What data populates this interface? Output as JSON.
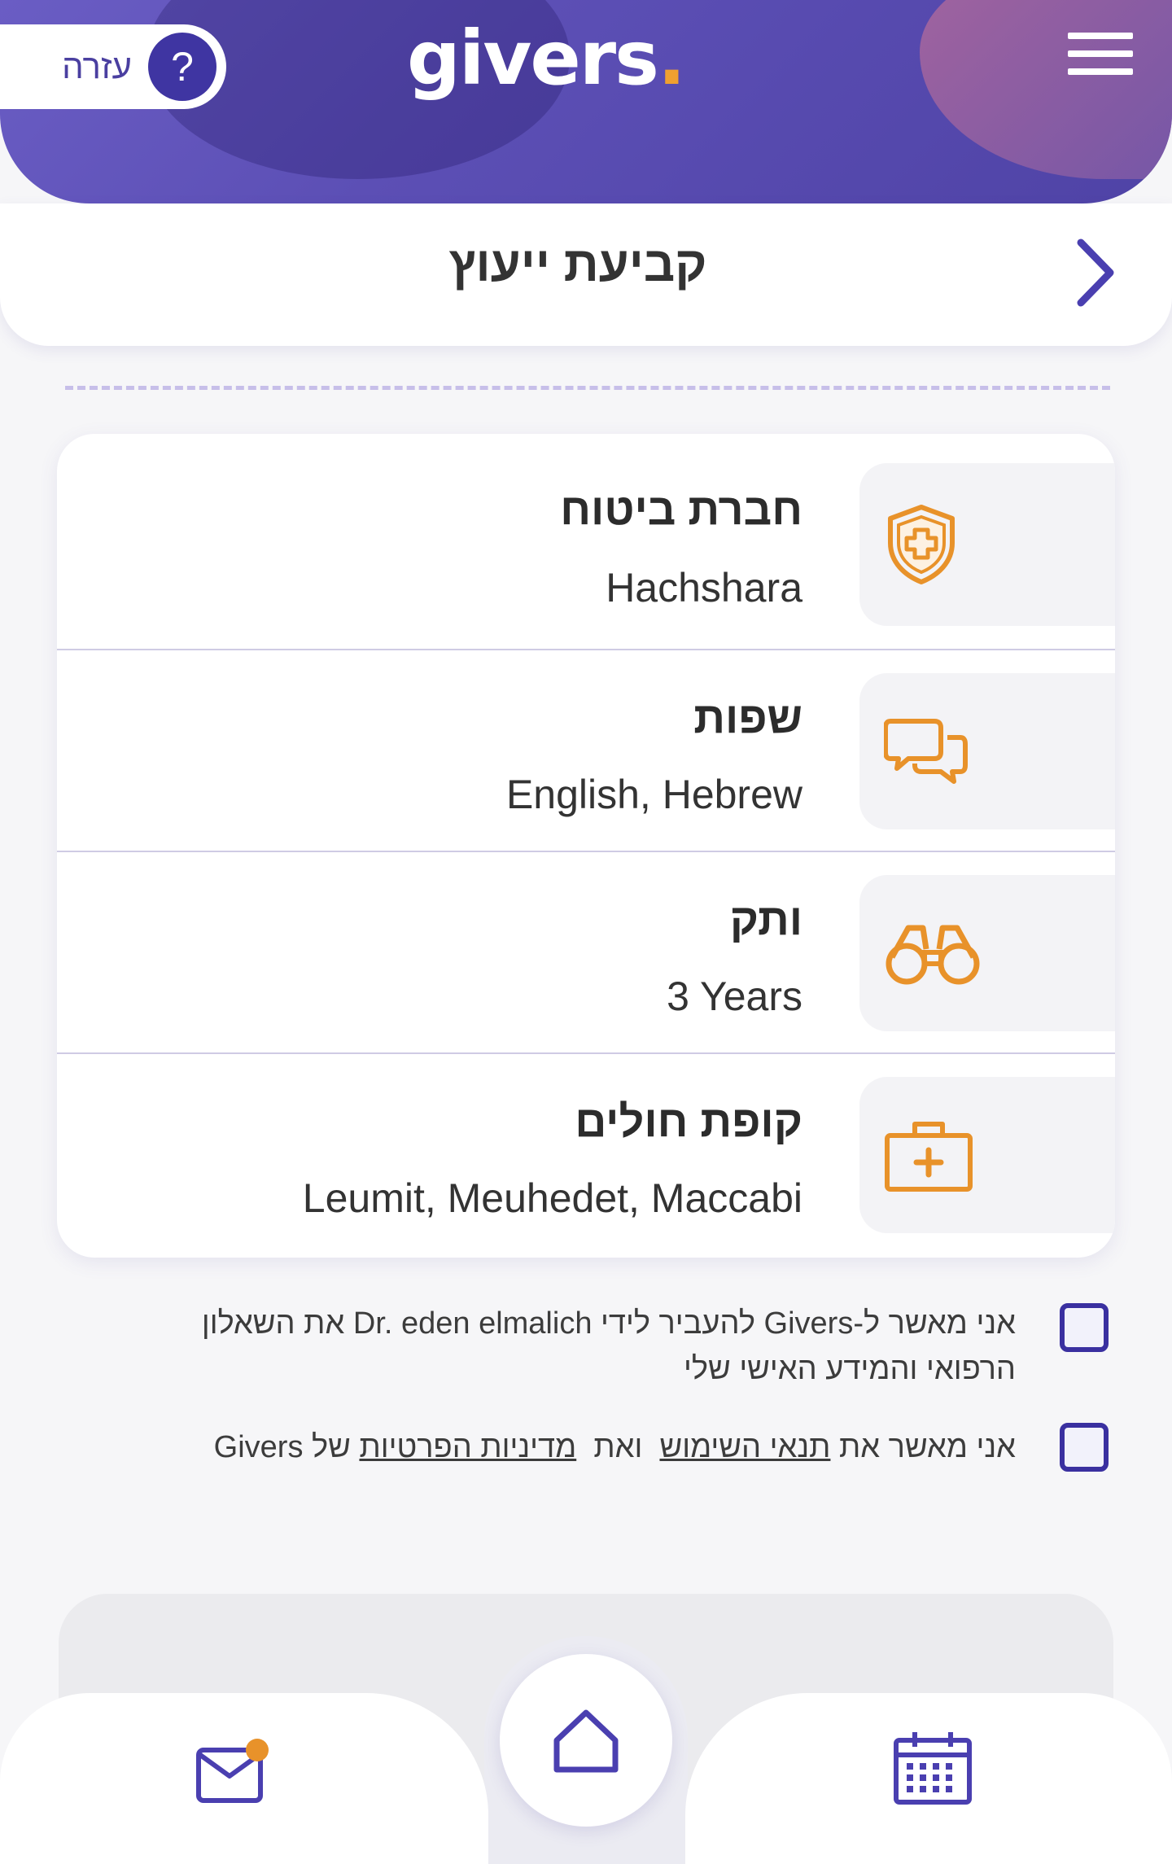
{
  "header": {
    "logo_text": "givers",
    "logo_dot": ".",
    "help_label": "עזרה",
    "help_symbol": "?",
    "menu_icon": "hamburger-icon"
  },
  "title_bar": {
    "title": "קביעת ייעוץ",
    "back_icon": "chevron-right-icon"
  },
  "details": [
    {
      "label": "חברת ביטוח",
      "value": "Hachshara",
      "icon": "shield-plus-icon"
    },
    {
      "label": "שפות",
      "value": "English, Hebrew",
      "icon": "chat-bubbles-icon"
    },
    {
      "label": "ותק",
      "value": "3 Years",
      "icon": "binoculars-icon"
    },
    {
      "label": "קופת חולים",
      "value": "Leumit, Meuhedet, Maccabi",
      "icon": "medical-kit-icon"
    }
  ],
  "consents": {
    "medical_share": {
      "line1": "אני מאשר ל-Givers להעביר לידי Dr. eden elmalich את השאלון",
      "line2": "הרפואי והמידע האישי שלי"
    },
    "terms": {
      "prefix": "אני מאשר את",
      "terms_link": "תנאי השימוש",
      "middle": "ואת",
      "privacy_link": "מדיניות הפרטיות",
      "suffix": "של Givers"
    }
  },
  "bottom_nav": {
    "left_icon": "mail-notification-icon",
    "center_icon": "home-icon",
    "right_icon": "calendar-icon"
  },
  "colors": {
    "brand_purple": "#3f35a2",
    "accent_orange": "#e8922a",
    "header_purple": "#5c4fb5"
  }
}
